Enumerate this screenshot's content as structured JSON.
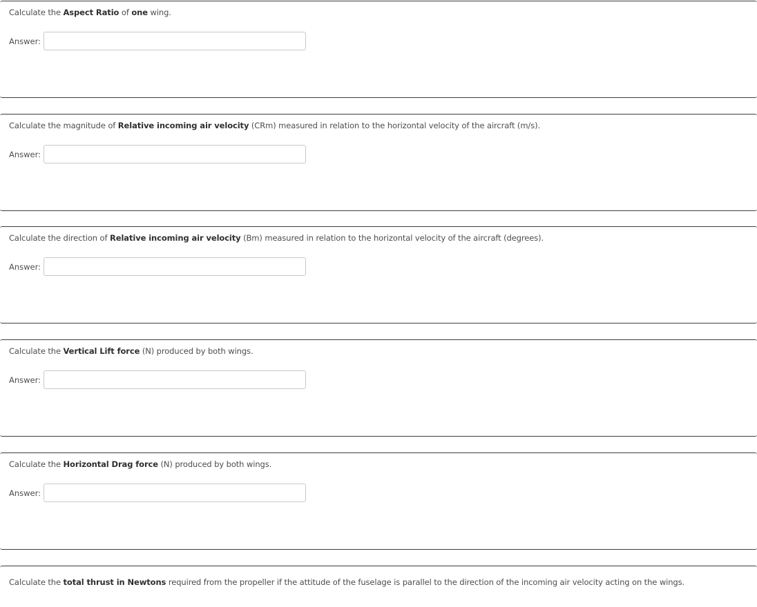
{
  "questions": [
    {
      "parts": [
        {
          "text": "Calculate the ",
          "bold": false
        },
        {
          "text": "Aspect Ratio",
          "bold": true
        },
        {
          "text": " of ",
          "bold": false
        },
        {
          "text": "one",
          "bold": true
        },
        {
          "text": " wing.",
          "bold": false
        }
      ],
      "answer_label": "Answer:",
      "answer_value": ""
    },
    {
      "parts": [
        {
          "text": "Calculate the magnitude of ",
          "bold": false
        },
        {
          "text": "Relative incoming air velocity",
          "bold": true
        },
        {
          "text": " (CRm) measured in relation to the horizontal velocity of the aircraft (m/s).",
          "bold": false
        }
      ],
      "answer_label": "Answer:",
      "answer_value": ""
    },
    {
      "parts": [
        {
          "text": "Calculate the direction of ",
          "bold": false
        },
        {
          "text": "Relative incoming air velocity",
          "bold": true
        },
        {
          "text": " (Bm) measured in relation to the horizontal velocity of the aircraft (degrees).",
          "bold": false
        }
      ],
      "answer_label": "Answer:",
      "answer_value": ""
    },
    {
      "parts": [
        {
          "text": "Calculate the ",
          "bold": false
        },
        {
          "text": "Vertical Lift force",
          "bold": true
        },
        {
          "text": " (N) produced by both wings.",
          "bold": false
        }
      ],
      "answer_label": "Answer:",
      "answer_value": ""
    },
    {
      "parts": [
        {
          "text": "Calculate the ",
          "bold": false
        },
        {
          "text": "Horizontal Drag force",
          "bold": true
        },
        {
          "text": " (N) produced by both wings.",
          "bold": false
        }
      ],
      "answer_label": "Answer:",
      "answer_value": ""
    },
    {
      "parts": [
        {
          "text": "Calculate the ",
          "bold": false
        },
        {
          "text": "total thrust in Newtons",
          "bold": true
        },
        {
          "text": " required from the propeller if the attitude of the fuselage is parallel to the direction of the incoming air velocity acting on the wings.",
          "bold": false
        }
      ]
    }
  ]
}
